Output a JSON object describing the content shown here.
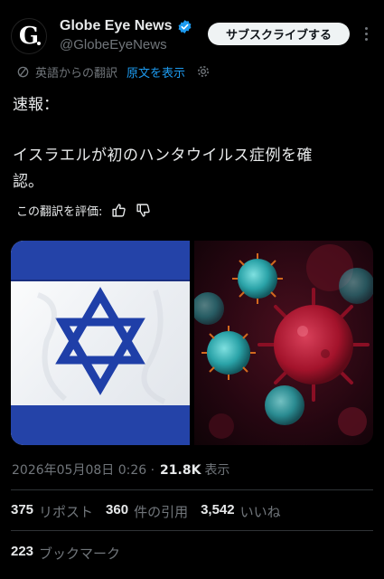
{
  "account": {
    "display_name": "Globe Eye News",
    "handle": "@GlobeEyeNews",
    "avatar_letter": "G",
    "subscribe_label": "サブスクライブする"
  },
  "translation": {
    "translated_from": "英語からの翻訳",
    "show_original": "原文を表示"
  },
  "tweet": {
    "line1": "速報：",
    "line2": "イスラエルが初のハンタウイルス症例を確",
    "line3": "認。"
  },
  "rate": {
    "label": "この翻訳を評価:"
  },
  "meta": {
    "timestamp": "2026年05月08日 0:26 · ",
    "views": "21.8K",
    "views_label": "表示"
  },
  "stats": {
    "reposts_count": "375",
    "reposts_label": "リポスト",
    "quotes_count": "360",
    "quotes_label": "件の引用",
    "likes_count": "3,542",
    "likes_label": "いいね",
    "bookmarks_count": "223",
    "bookmarks_label": "ブックマーク"
  },
  "colors": {
    "background": "#000000",
    "accent": "#1d9bf0",
    "flag_blue": "#1f3fa8",
    "virus_red": "#a3132b",
    "virus_teal": "#2aa3a8"
  },
  "icons": {
    "verified": "verified-badge-icon",
    "translate": "translate-icon",
    "settings": "gear-icon",
    "thumbs_up": "thumbs-up-icon",
    "thumbs_down": "thumbs-down-icon",
    "more": "more-options-icon"
  }
}
